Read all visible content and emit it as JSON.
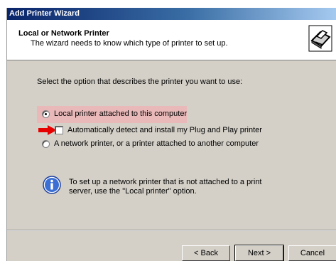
{
  "window": {
    "title": "Add Printer Wizard"
  },
  "header": {
    "title": "Local or Network Printer",
    "subtitle": "The wizard needs to know which type of printer to set up."
  },
  "prompt": "Select the option that describes the printer you want to use:",
  "options": {
    "local": {
      "label": "Local printer attached to this computer",
      "checked": true
    },
    "autodetect": {
      "label": "Automatically detect and install my Plug and Play printer",
      "checked": false
    },
    "network": {
      "label": "A network printer, or a printer attached to another computer",
      "checked": false
    }
  },
  "info_text": "To set up a network printer that is not attached to a print server, use the \"Local printer\" option.",
  "buttons": {
    "back": "< Back",
    "next": "Next >",
    "cancel": "Cancel"
  },
  "colors": {
    "highlight": "#e9b9b9",
    "arrow": "#e60000",
    "title_bar": "#0a246a"
  }
}
